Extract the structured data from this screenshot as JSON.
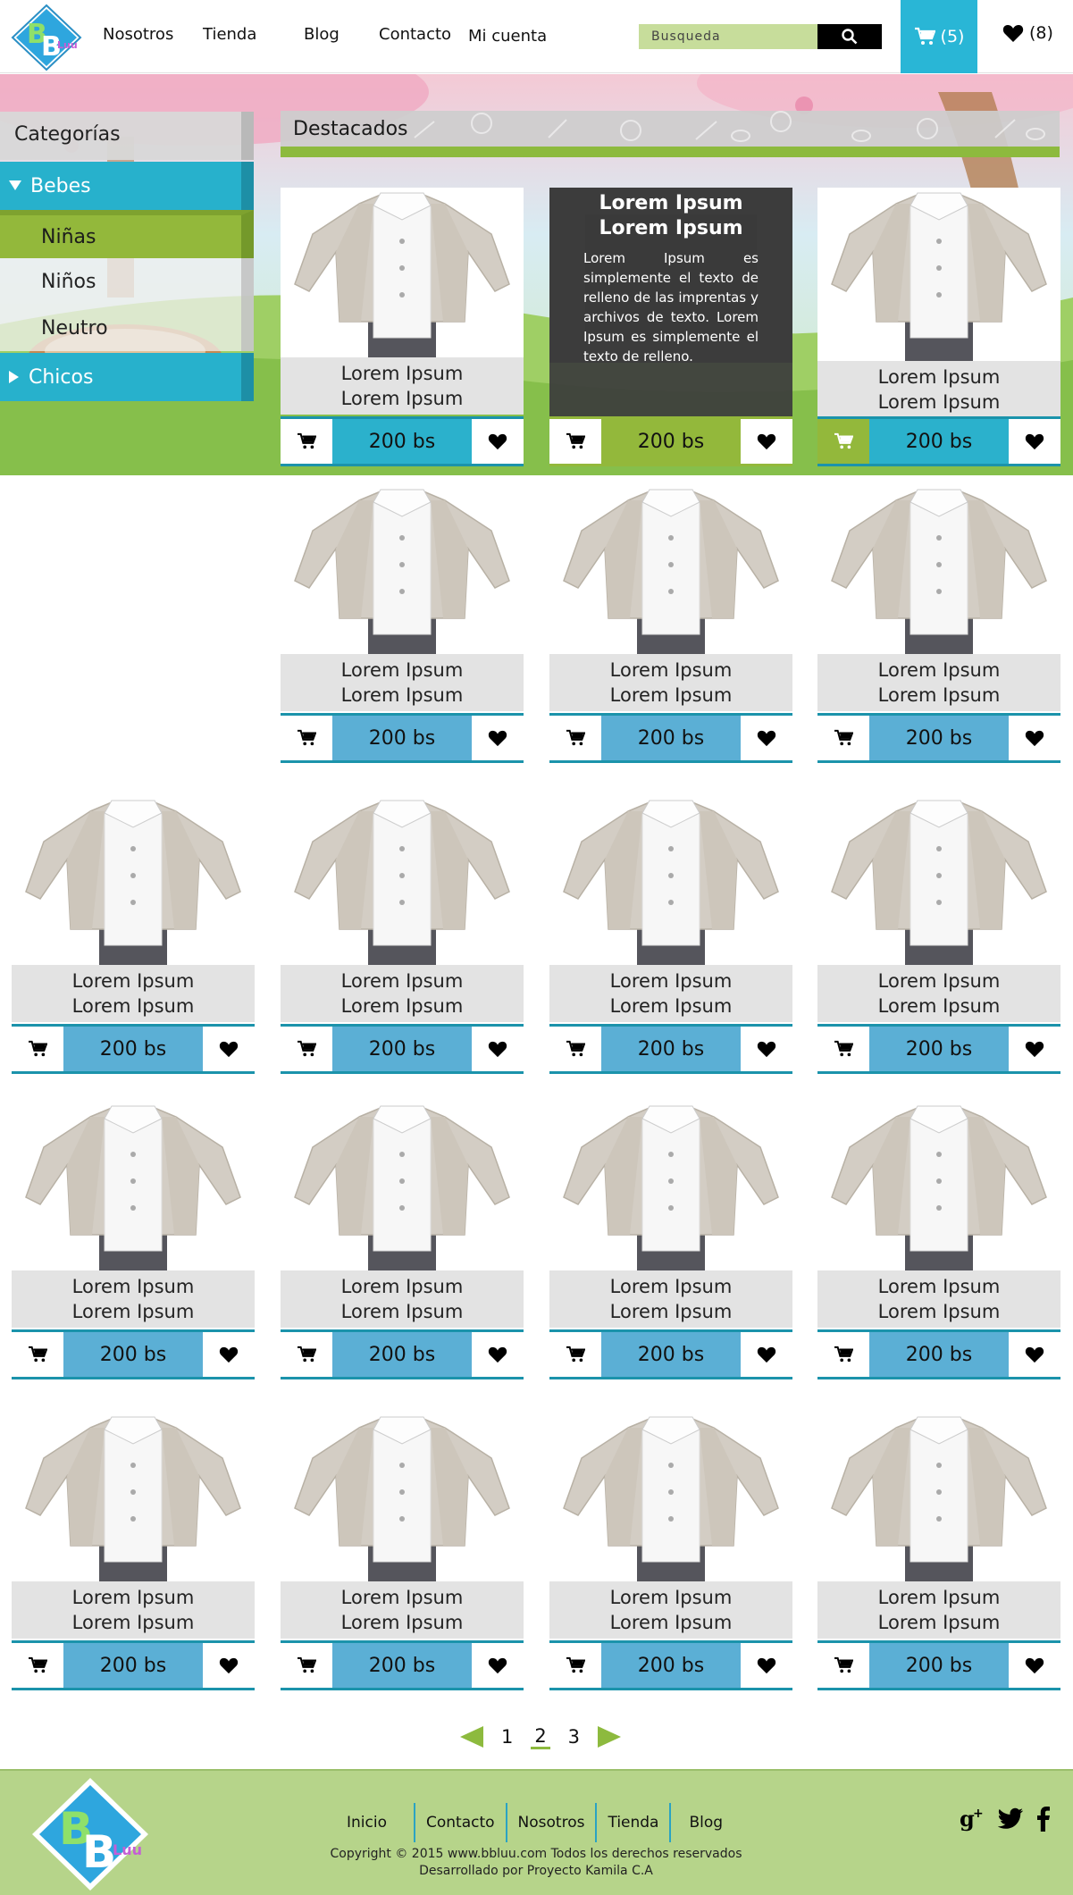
{
  "nav": {
    "items": [
      "Nosotros",
      "Tienda",
      "Blog",
      "Contacto",
      "Mi cuenta"
    ]
  },
  "search": {
    "placeholder": "Busqueda"
  },
  "cart": {
    "count": "(5)"
  },
  "favorites": {
    "count": "(8)"
  },
  "logo": {
    "text": "BB Luu"
  },
  "sidebar": {
    "title": "Categorías",
    "categories": [
      {
        "label": "Bebes",
        "expanded": true,
        "sub": [
          "Niñas",
          "Niños",
          "Neutro"
        ],
        "active_sub": "Niñas"
      },
      {
        "label": "Chicos",
        "expanded": false
      }
    ]
  },
  "featured": {
    "title": "Destacados",
    "overlay_title": "Lorem Ipsum Lorem Ipsum",
    "overlay_text": "Lorem Ipsum es simplemente el texto de relleno de las imprentas y archivos de texto. Lorem Ipsum es simplemente el texto de relleno."
  },
  "product": {
    "name_line1": "Lorem Ipsum",
    "name_line2": "Lorem Ipsum",
    "price": "200 bs"
  },
  "pagination": {
    "pages": [
      "1",
      "2",
      "3"
    ],
    "current": "2"
  },
  "footer": {
    "links": [
      "Inicio",
      "Contacto",
      "Nosotros",
      "Tienda",
      "Blog"
    ],
    "copyright": "Copyright © 2015 www.bbluu.com Todos los derechos reservados",
    "developer": "Desarrollado por Proyecto Kamila C.A"
  },
  "colors": {
    "accent_blue": "#29b6d6",
    "price_blue": "#5bafd5",
    "green": "#8dba3e",
    "footer_green": "#b6d48a"
  }
}
